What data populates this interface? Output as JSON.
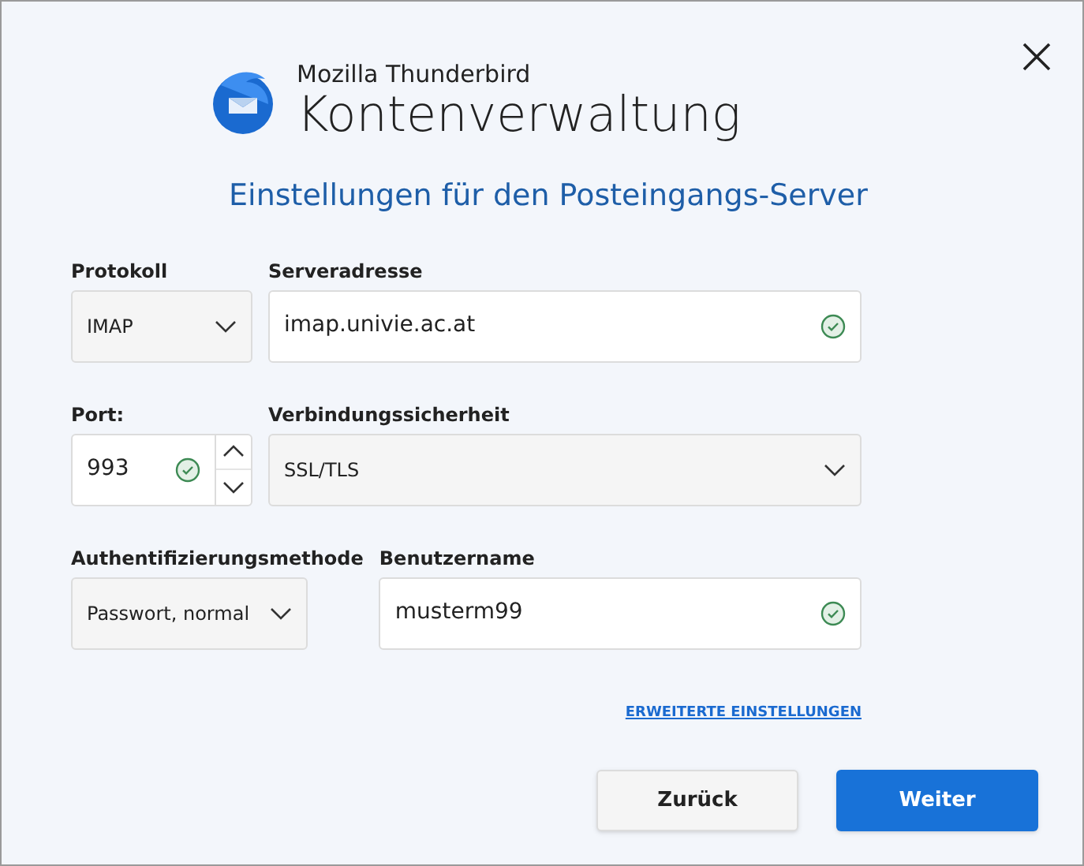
{
  "app": {
    "name": "Mozilla Thunderbird",
    "title": "Kontenverwaltung"
  },
  "heading": "Einstellungen für den Posteingangs-Server",
  "protocol": {
    "label": "Protokoll",
    "value": "IMAP"
  },
  "server": {
    "label": "Serveradresse",
    "value": "imap.univie.ac.at",
    "valid": true
  },
  "port": {
    "label": "Port:",
    "value": "993",
    "valid": true
  },
  "security": {
    "label": "Verbindungssicherheit",
    "value": "SSL/TLS"
  },
  "auth": {
    "label": "Authentifizierungsmethode",
    "value": "Passwort, normal"
  },
  "username": {
    "label": "Benutzername",
    "value": "musterm99",
    "valid": true
  },
  "advanced_link": "ERWEITERTE EINSTELLUNGEN",
  "buttons": [
    {
      "label": "Zurück",
      "kind": "secondary"
    },
    {
      "label": "Weiter",
      "kind": "primary"
    }
  ]
}
